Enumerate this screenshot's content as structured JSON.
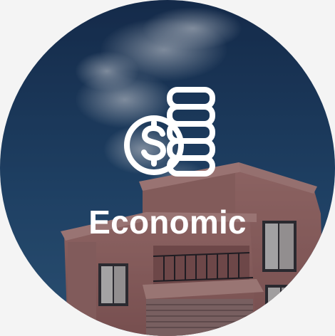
{
  "category": {
    "label": "Economic",
    "icon": "money-coins-icon",
    "background": "building-under-sky-photo"
  },
  "colors": {
    "sky_top": "#1d3a5e",
    "sky_bottom": "#2f5a82",
    "building": "#c98d84",
    "overlay": "rgba(8,18,38,0.35)",
    "text": "#ffffff",
    "page_bg": "#f4f4f4"
  }
}
